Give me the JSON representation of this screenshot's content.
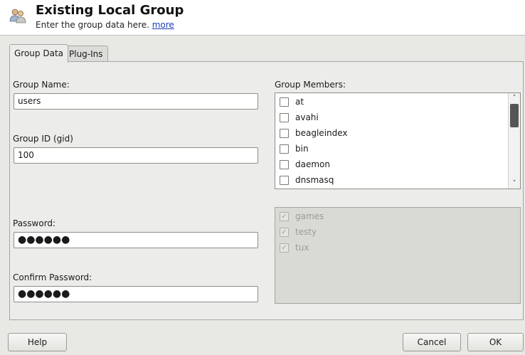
{
  "header": {
    "title": "Existing Local Group",
    "subtitle": "Enter the group data here.",
    "more_link": "more",
    "icon": "users-group-icon"
  },
  "tabs": [
    {
      "label": "Group Data",
      "active": true
    },
    {
      "label": "Plug-Ins",
      "active": false
    }
  ],
  "form": {
    "group_name_label": "Group Name:",
    "group_name_value": "users",
    "group_id_label": "Group ID (gid)",
    "group_id_value": "100",
    "password_label": "Password:",
    "password_value": "●●●●●●",
    "confirm_password_label": "Confirm Password:",
    "confirm_password_value": "●●●●●●"
  },
  "members": {
    "label": "Group Members:",
    "items": [
      {
        "label": "at",
        "checked": false
      },
      {
        "label": "avahi",
        "checked": false
      },
      {
        "label": "beagleindex",
        "checked": false
      },
      {
        "label": "bin",
        "checked": false
      },
      {
        "label": "daemon",
        "checked": false
      },
      {
        "label": "dnsmasq",
        "checked": false
      }
    ],
    "fixed_items": [
      {
        "label": "games",
        "checked": true
      },
      {
        "label": "testy",
        "checked": true
      },
      {
        "label": "tux",
        "checked": true
      }
    ]
  },
  "buttons": {
    "help": "Help",
    "cancel": "Cancel",
    "ok": "OK"
  },
  "colors": {
    "background": "#e8e8e5",
    "link": "#1c3fb8"
  }
}
